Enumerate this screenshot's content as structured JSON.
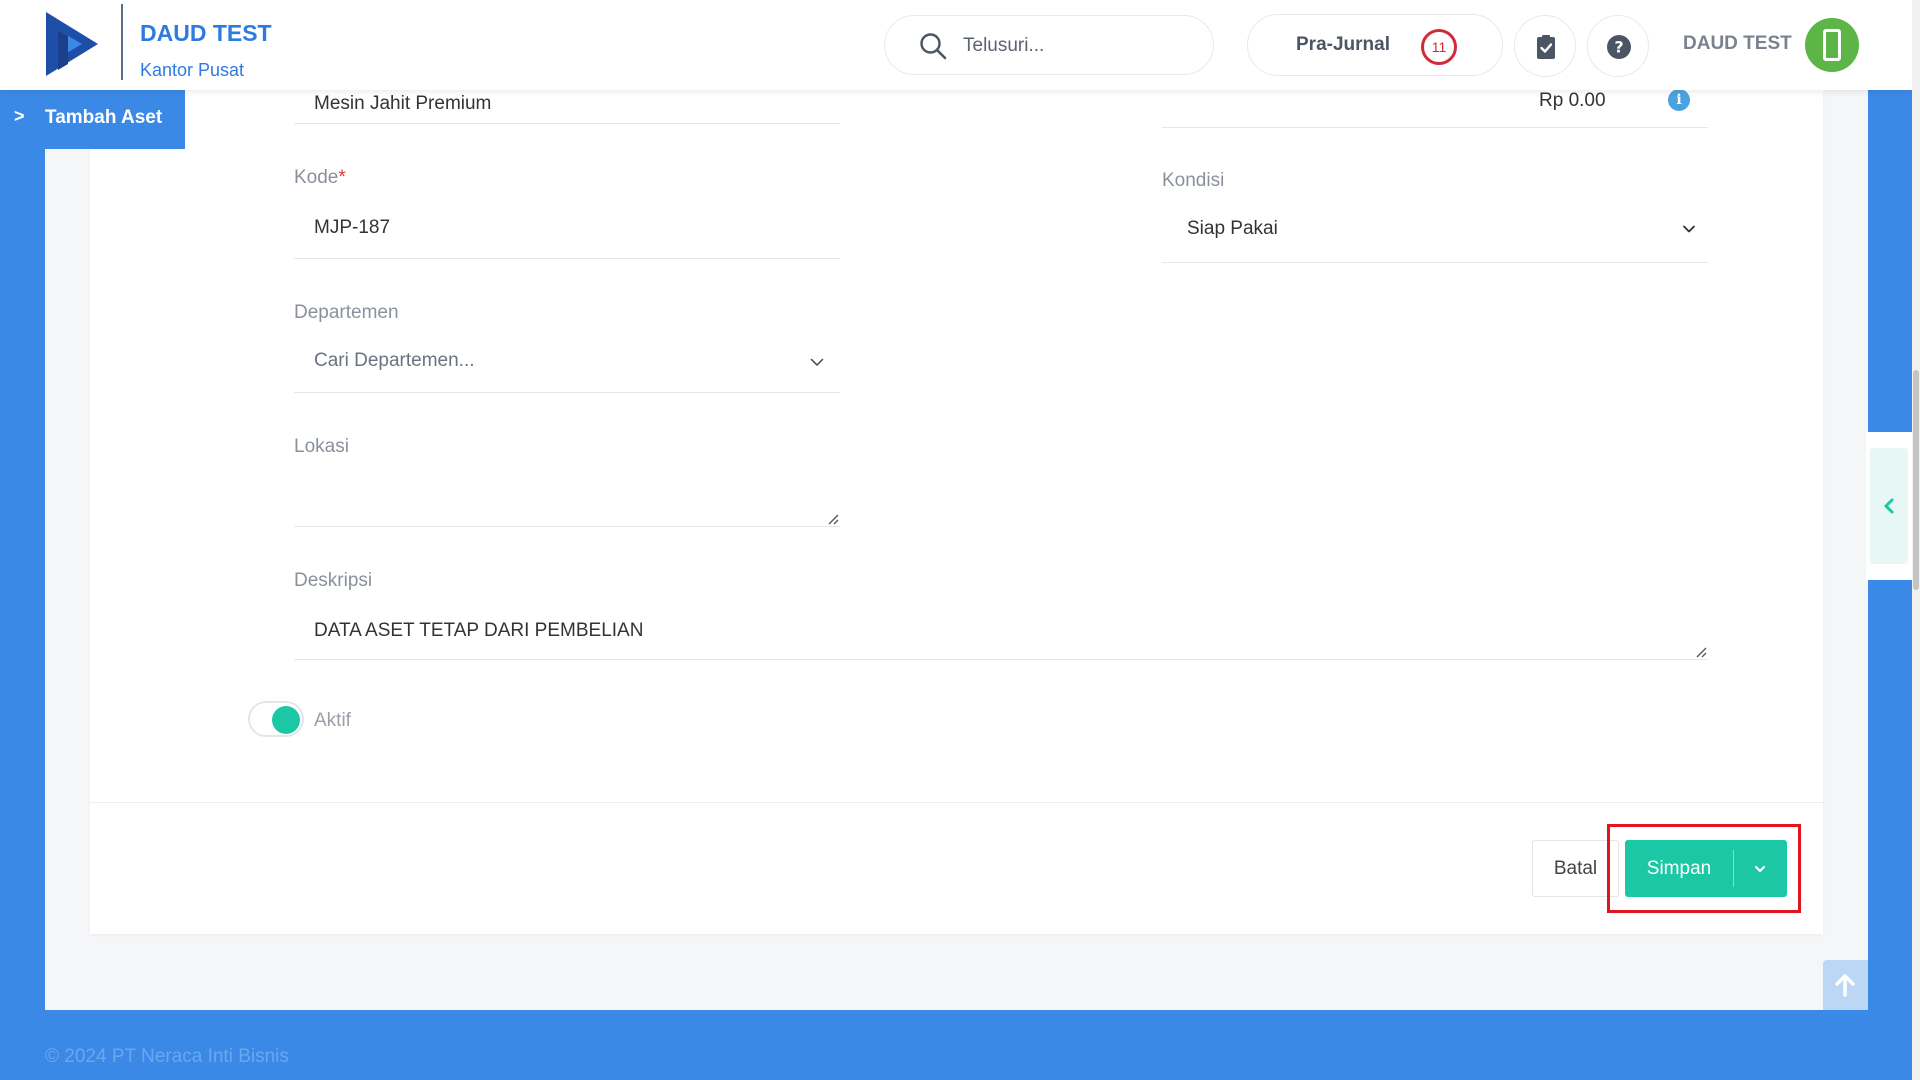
{
  "header": {
    "company": "DAUD TEST",
    "office": "Kantor Pusat",
    "search_placeholder": "Telusuri...",
    "prajurnal_label": "Pra-Jurnal",
    "prajurnal_count": "11",
    "user_name": "DAUD TEST"
  },
  "breadcrumb": {
    "label": "Tambah Aset"
  },
  "form": {
    "name_value": "Mesin Jahit Premium",
    "price_value": "Rp 0.00",
    "kode_label": "Kode",
    "kode_required": "*",
    "kode_value": "MJP-187",
    "kondisi_label": "Kondisi",
    "kondisi_value": "Siap Pakai",
    "departemen_label": "Departemen",
    "departemen_placeholder": "Cari Departemen...",
    "lokasi_label": "Lokasi",
    "lokasi_value": "",
    "deskripsi_label": "Deskripsi",
    "deskripsi_value": "DATA ASET TETAP DARI PEMBELIAN",
    "aktif_label": "Aktif",
    "aktif_on": true
  },
  "actions": {
    "cancel_label": "Batal",
    "save_label": "Simpan"
  },
  "footer": {
    "copyright": "© 2024 PT Neraca Inti Bisnis"
  },
  "colors": {
    "primary_blue": "#3b89e6",
    "accent_teal": "#1cc7a6",
    "badge_red": "#d12b3a",
    "avatar_green": "#5cb546",
    "highlight_red": "#e0151f"
  },
  "icons": {
    "logo": "play-logo-icon",
    "search": "search-icon",
    "task": "clipboard-check-icon",
    "help": "question-circle-icon",
    "avatar": "mobile-phone-icon",
    "side": "chevron-left-icon",
    "top": "arrow-up-icon"
  }
}
